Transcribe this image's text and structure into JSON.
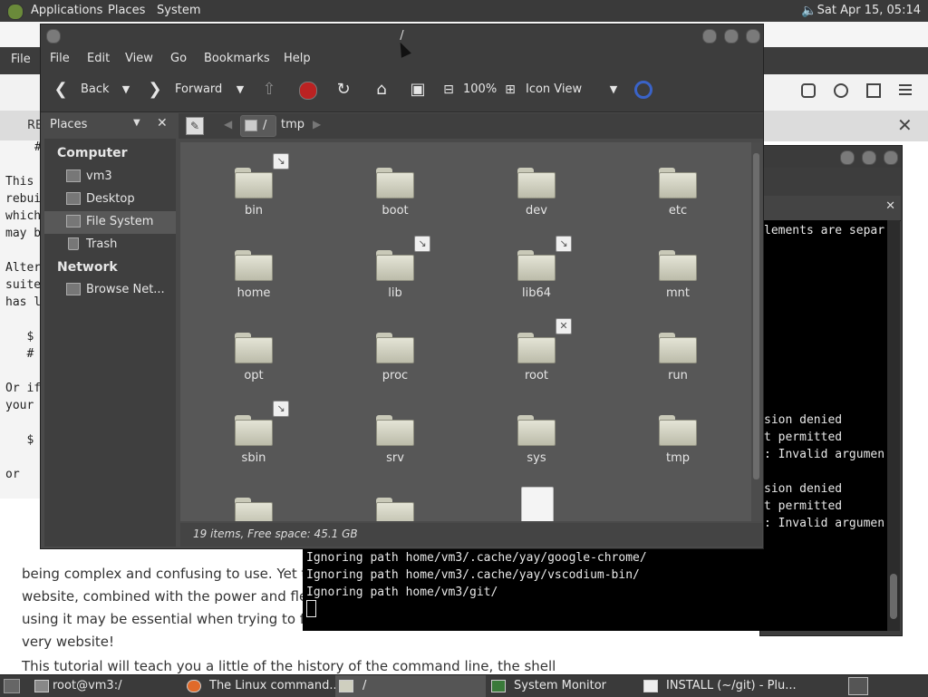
{
  "top_panel": {
    "applications": "Applications",
    "places": "Places",
    "system": "System",
    "clock": "Sat Apr 15, 05:14"
  },
  "browser": {
    "file_menu": "File",
    "tab_label": "RE",
    "page_lines": [
      "being complex and confusing to use. Yet the",
      "website, combined with the power and flex",
      "using it may be essential when trying to foll",
      "very website!",
      "This tutorial will teach you a little of the history of the command line, the shell"
    ],
    "left_doc_lines": [
      "#",
      "",
      "This",
      "rebui",
      "which",
      "may b",
      "",
      "Alter",
      "suite",
      "has l",
      "",
      "   $",
      "   #",
      "",
      "Or if",
      "your",
      "",
      "   $",
      "",
      "or"
    ]
  },
  "terminal": {
    "fragments": [
      "lements are separ",
      "sion denied",
      "t permitted",
      ": Invalid argumen",
      "sion denied",
      "t permitted",
      ": Invalid argumen"
    ],
    "lines": [
      "Ignoring path home/vm3/.cache/yay/google-chrome/",
      "Ignoring path home/vm3/.cache/yay/vscodium-bin/",
      "Ignoring path home/vm3/git/"
    ]
  },
  "file_manager": {
    "title": "/",
    "menu": [
      "File",
      "Edit",
      "View",
      "Go",
      "Bookmarks",
      "Help"
    ],
    "toolbar": {
      "back": "Back",
      "forward": "Forward",
      "zoom": "100%",
      "view_mode": "Icon View"
    },
    "sidebar": {
      "selector": "Places",
      "computer_header": "Computer",
      "network_header": "Network",
      "items": [
        "vm3",
        "Desktop",
        "File System",
        "Trash"
      ],
      "network_items": [
        "Browse Net..."
      ]
    },
    "pathbar": [
      "/",
      "tmp"
    ],
    "files": [
      {
        "name": "bin",
        "emblem": "link"
      },
      {
        "name": "boot",
        "emblem": ""
      },
      {
        "name": "dev",
        "emblem": ""
      },
      {
        "name": "etc",
        "emblem": ""
      },
      {
        "name": "home",
        "emblem": ""
      },
      {
        "name": "lib",
        "emblem": "link"
      },
      {
        "name": "lib64",
        "emblem": "link"
      },
      {
        "name": "mnt",
        "emblem": ""
      },
      {
        "name": "opt",
        "emblem": ""
      },
      {
        "name": "proc",
        "emblem": ""
      },
      {
        "name": "root",
        "emblem": "locked"
      },
      {
        "name": "run",
        "emblem": ""
      },
      {
        "name": "sbin",
        "emblem": "link"
      },
      {
        "name": "srv",
        "emblem": ""
      },
      {
        "name": "sys",
        "emblem": ""
      },
      {
        "name": "tmp",
        "emblem": ""
      },
      {
        "name": "",
        "emblem": ""
      },
      {
        "name": "",
        "emblem": ""
      },
      {
        "name": "",
        "emblem": "",
        "type": "file"
      }
    ],
    "status": "19 items, Free space: 45.1 GB"
  },
  "taskbar": [
    {
      "label": "root@vm3:/",
      "icon": "terminal-icon"
    },
    {
      "label": "The Linux command...",
      "icon": "firefox-icon"
    },
    {
      "label": "/",
      "icon": "folder-icon"
    },
    {
      "label": "System Monitor",
      "icon": "system-monitor-icon"
    },
    {
      "label": "INSTALL (~/git) - Plu...",
      "icon": "text-editor-icon"
    }
  ]
}
